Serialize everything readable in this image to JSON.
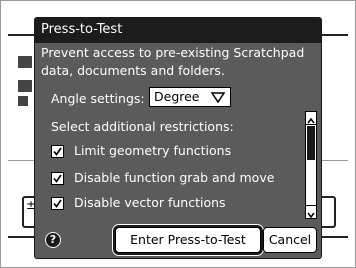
{
  "dialog": {
    "title": "Press-to-Test",
    "description": "Prevent access to pre-existing Scratchpad data, documents and folders.",
    "angle_label": "Angle settings:",
    "angle_value": "Degree",
    "restrictions_label": "Select additional restrictions:",
    "options": [
      {
        "label": "Limit geometry functions",
        "checked": true
      },
      {
        "label": "Disable function grab and move",
        "checked": true
      },
      {
        "label": "Disable vector functions",
        "checked": true
      }
    ],
    "enter_button": "Enter Press-to-Test",
    "cancel_button": "Cancel",
    "help_icon": "?"
  },
  "background": {
    "left_button_glyph": "±"
  },
  "icons": {
    "dropdown": "chevron-down-icon",
    "check": "check-icon",
    "scroll_up": "arrow-up-icon",
    "scroll_down": "arrow-down-icon",
    "help": "question-icon"
  },
  "colors": {
    "dialog_bg": "#5b5b5b",
    "title_bg": "#1c1c1c",
    "text": "#ffffff"
  }
}
